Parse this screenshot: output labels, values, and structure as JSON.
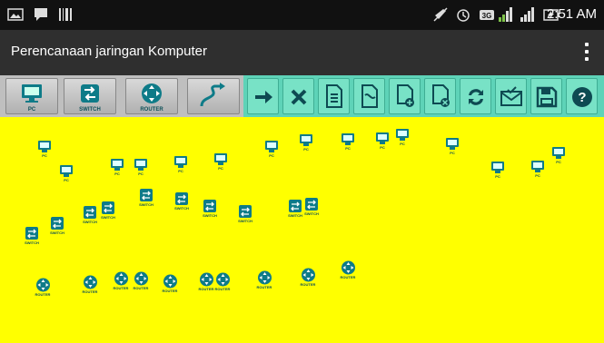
{
  "status_bar": {
    "time": "2:51 AM",
    "icons": [
      "image-icon",
      "bbm-icon",
      "barcode-icon",
      "mute-icon",
      "alarm-icon",
      "3g-icon",
      "signal-icon",
      "signal-icon",
      "battery-charging-icon"
    ]
  },
  "action_bar": {
    "title": "Perencanaan jaringan Komputer",
    "menu_icon": "overflow-menu-icon"
  },
  "toolbar": {
    "palette": [
      {
        "name": "PC",
        "icon": "pc-icon"
      },
      {
        "name": "SWITCH",
        "icon": "switch-icon"
      },
      {
        "name": "ROUTER",
        "icon": "router-icon"
      },
      {
        "name": "",
        "icon": "cable-icon"
      }
    ],
    "actions": [
      "arrow-right-icon",
      "close-icon",
      "document-icon",
      "document-connect-icon",
      "document-add-icon",
      "document-remove-icon",
      "refresh-icon",
      "mail-check-icon",
      "save-icon",
      "help-icon"
    ]
  },
  "canvas": {
    "background": "#ffff00",
    "device_color": "#0e7b88",
    "pc_label": "PC",
    "switch_label": "SWITCH",
    "router_label": "ROUTER",
    "pc_count": 20,
    "switch_count": 14,
    "router_count": 12
  }
}
